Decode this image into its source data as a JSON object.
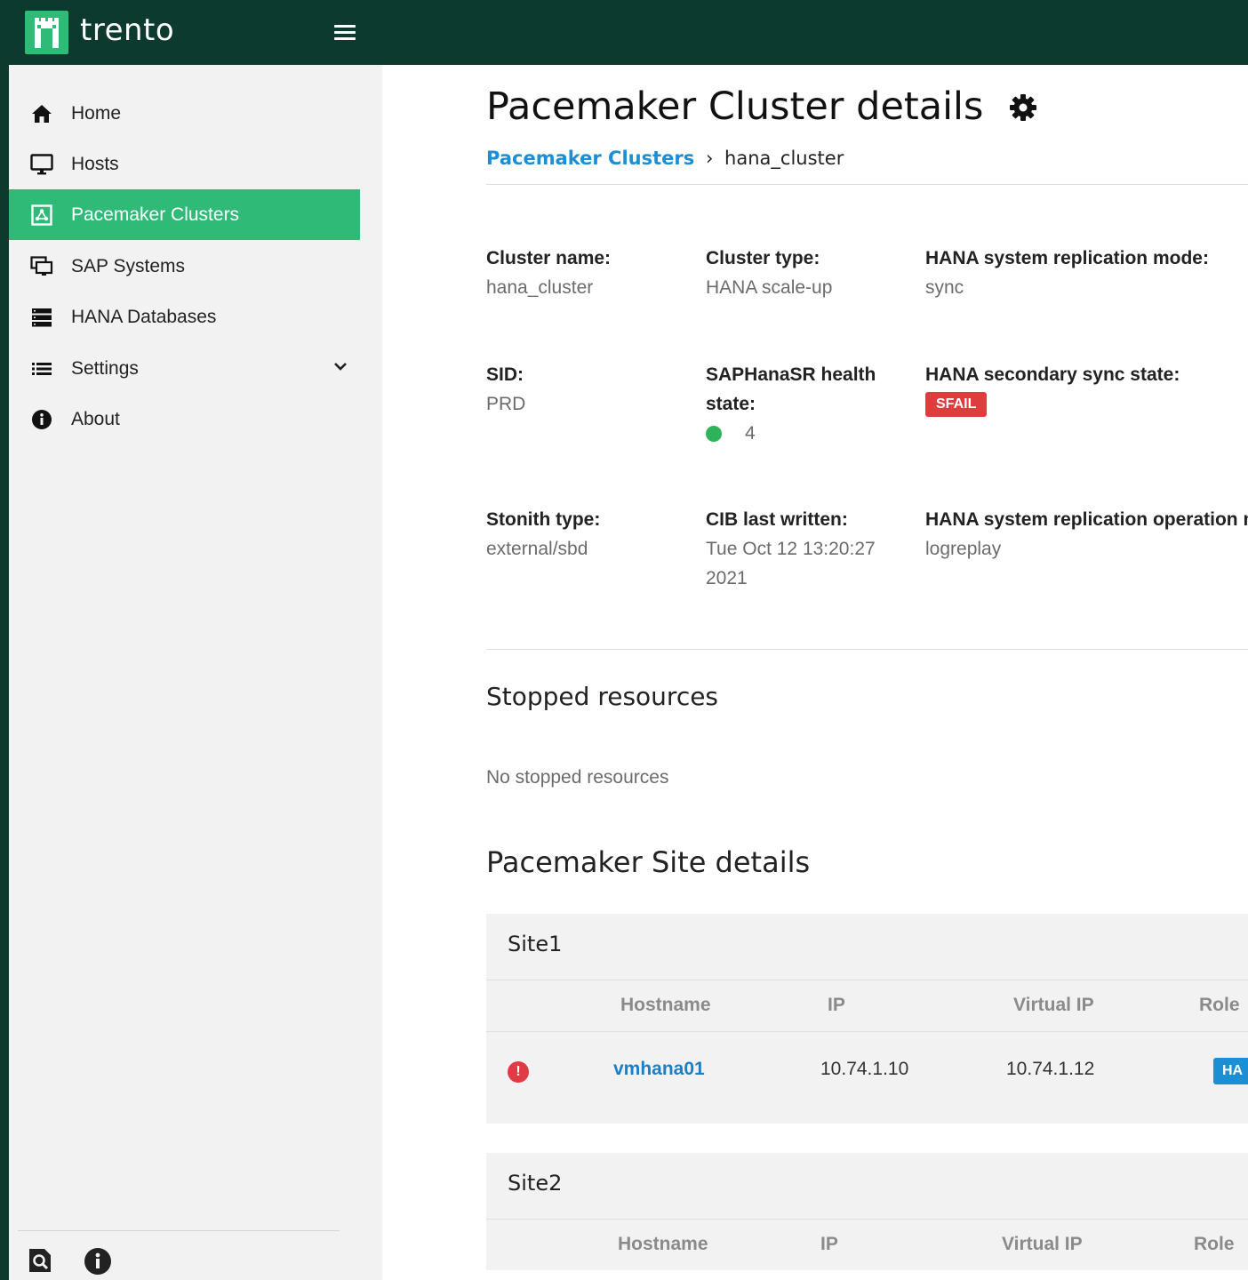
{
  "app": {
    "brand": "trento"
  },
  "sidebar": {
    "items": [
      {
        "label": "Home",
        "icon": "home-icon"
      },
      {
        "label": "Hosts",
        "icon": "monitor-icon"
      },
      {
        "label": "Pacemaker Clusters",
        "icon": "cluster-icon",
        "active": true
      },
      {
        "label": "SAP Systems",
        "icon": "sap-systems-icon"
      },
      {
        "label": "HANA Databases",
        "icon": "database-icon"
      },
      {
        "label": "Settings",
        "icon": "list-icon",
        "expandable": true
      },
      {
        "label": "About",
        "icon": "info-icon"
      }
    ],
    "footer_icons": [
      "search-doc-icon",
      "info-icon"
    ]
  },
  "page": {
    "title": "Pacemaker Cluster details",
    "breadcrumb": {
      "parent": "Pacemaker Clusters",
      "separator": "›",
      "current": "hana_cluster"
    }
  },
  "details": {
    "cluster_name_label": "Cluster name:",
    "cluster_name_value": "hana_cluster",
    "cluster_type_label": "Cluster type:",
    "cluster_type_value": "HANA scale-up",
    "replication_mode_label": "HANA system replication mode:",
    "replication_mode_value": "sync",
    "sid_label": "SID:",
    "sid_value": "PRD",
    "health_label_line1": "SAPHanaSR health",
    "health_label_line2": "state:",
    "health_value": "4",
    "sync_state_label": "HANA secondary sync state:",
    "sync_state_value": "SFAIL",
    "stonith_label": "Stonith type:",
    "stonith_value": "external/sbd",
    "cib_label": "CIB last written:",
    "cib_value_line1": "Tue Oct 12 13:20:27",
    "cib_value_line2": "2021",
    "operation_mode_label": "HANA system replication operation m",
    "operation_mode_value": "logreplay"
  },
  "stopped": {
    "title": "Stopped resources",
    "empty": "No stopped resources"
  },
  "sites": {
    "title": "Pacemaker Site details",
    "columns": [
      "Hostname",
      "IP",
      "Virtual IP",
      "Role"
    ],
    "list": [
      {
        "name": "Site1",
        "columns": [
          "Hostname",
          "IP",
          "Virtual IP",
          "Role"
        ],
        "rows": [
          {
            "status": "!",
            "hostname": "vmhana01",
            "ip": "10.74.1.10",
            "virtual_ip": "10.74.1.12",
            "role": "HA"
          }
        ]
      },
      {
        "name": "Site2",
        "columns": [
          "Hostname",
          "IP",
          "Virtual IP",
          "Role"
        ],
        "rows": []
      }
    ]
  },
  "colors": {
    "topbar": "#0c3a2e",
    "accent": "#30ba78",
    "link": "#1a8fd6",
    "danger": "#de3d3d",
    "healthy": "#2eb35a"
  }
}
